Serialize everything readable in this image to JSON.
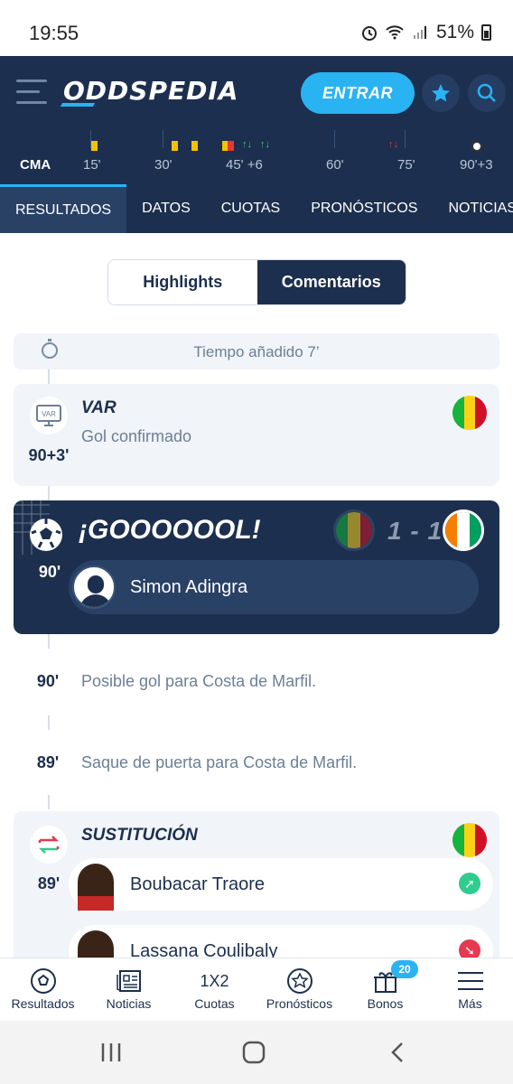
{
  "status_bar": {
    "time": "19:55",
    "battery": "51%"
  },
  "header": {
    "logo": "ODDSPEDIA",
    "login_label": "ENTRAR"
  },
  "timeline": {
    "team_label": "CMA",
    "minutes": [
      "15'",
      "30'",
      "45' +6",
      "60'",
      "75'",
      "90'+3"
    ]
  },
  "tabs": [
    "RESULTADOS",
    "DATOS",
    "CUOTAS",
    "PRONÓSTICOS",
    "NOTICIAS"
  ],
  "toggle": {
    "left": "Highlights",
    "right": "Comentarios",
    "active": "Comentarios"
  },
  "events": {
    "added_time": "Tiempo añadido 7’",
    "var": {
      "title": "VAR",
      "subtitle": "Gol confirmado",
      "minute": "90+3'",
      "icon_text": "VAR"
    },
    "goal": {
      "title": "¡GOOOOOOL!",
      "score": "1 - 1",
      "minute": "90'",
      "player": "Simon Adingra"
    },
    "comment1": {
      "minute": "90'",
      "text": "Posible gol para Costa de Marfil."
    },
    "comment2": {
      "minute": "89'",
      "text": "Saque de puerta para Costa de Marfil."
    },
    "substitution": {
      "title": "SUSTITUCIÓN",
      "minute": "89'",
      "player_in": "Boubacar Traore",
      "player_out": "Lassana Coulibaly"
    }
  },
  "colors": {
    "navy": "#1c2f4e",
    "accent": "#29b3f3",
    "mali_flag": [
      "#14b53a",
      "#fcd116",
      "#ce1126"
    ],
    "ivory_flag": [
      "#f77f00",
      "#ffffff",
      "#009e60"
    ]
  },
  "bottom_nav": [
    {
      "label": "Resultados",
      "icon": "soccer-ball-icon"
    },
    {
      "label": "Noticias",
      "icon": "newspaper-icon"
    },
    {
      "label": "Cuotas",
      "icon": "1x2-icon",
      "icon_text": "1X2"
    },
    {
      "label": "Pronósticos",
      "icon": "star-badge-icon"
    },
    {
      "label": "Bonos",
      "icon": "gift-icon",
      "badge": "20"
    },
    {
      "label": "Más",
      "icon": "menu-icon"
    }
  ]
}
